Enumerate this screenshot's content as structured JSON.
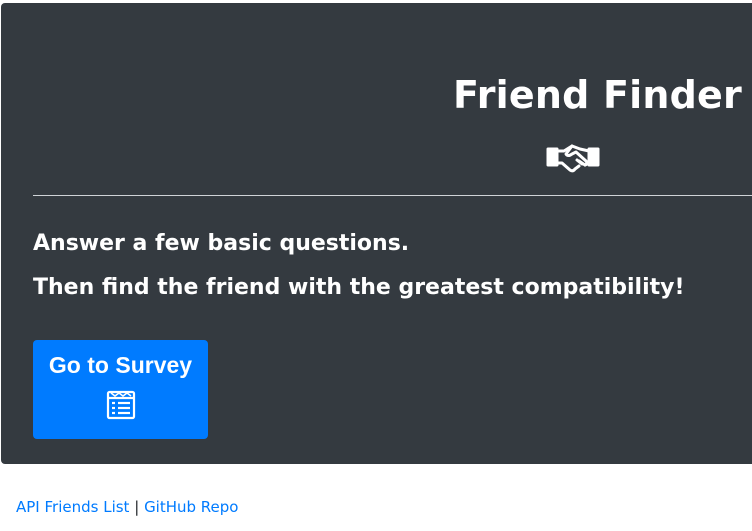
{
  "header": {
    "title": "Friend Finder",
    "icon": "handshake-icon"
  },
  "intro": {
    "line1": "Answer a few basic questions.",
    "line2": "Then find the friend with the greatest compatibility!"
  },
  "cta": {
    "label": "Go to Survey",
    "icon": "survey-list-icon",
    "color": "#007bff"
  },
  "footer": {
    "link1": "API Friends List",
    "separator": "|",
    "link2": "GitHub Repo",
    "link_color": "#007bff"
  },
  "theme": {
    "panel_bg": "#343a40",
    "text": "#ffffff"
  }
}
